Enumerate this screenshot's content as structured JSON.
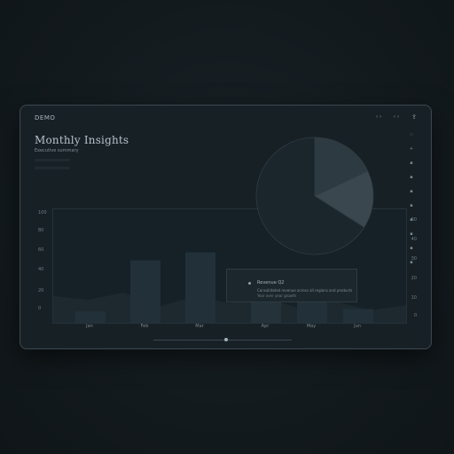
{
  "window": {
    "brand": "DEMO",
    "title": "Monthly Insights",
    "subtitle": "Executive summary"
  },
  "toolbar": {
    "icons": [
      {
        "name": "filter-icon",
        "label": "◦◦"
      },
      {
        "name": "settings-icon",
        "label": "◦◦"
      },
      {
        "name": "share-icon",
        "label": "⇪"
      }
    ]
  },
  "right_rail": {
    "items": [
      "∷",
      "+",
      "▪",
      "▪",
      "▪",
      "▪",
      "▪",
      "▪",
      "▪",
      "▪"
    ]
  },
  "chart": {
    "y_left_ticks": [
      "100",
      "80",
      "60",
      "40",
      "20",
      "0"
    ],
    "y_right_ticks": [
      "60",
      "40",
      "30",
      "20",
      "10",
      "0"
    ],
    "x_labels": [
      "Jan",
      "Feb",
      "Mar",
      "Apr",
      "May",
      "Jun"
    ],
    "bars": [
      10,
      55,
      62,
      40,
      46,
      12
    ],
    "area": [
      30,
      26,
      34,
      18,
      30,
      22,
      28,
      16,
      24,
      14,
      20
    ],
    "pie": [
      0.18,
      0.16,
      0.66
    ],
    "pie_colors": [
      "#2e3a41",
      "#3b474e",
      "#1b262c"
    ]
  },
  "chart_data": {
    "type": "bar",
    "categories": [
      "Jan",
      "Feb",
      "Mar",
      "Apr",
      "May",
      "Jun"
    ],
    "values": [
      10,
      55,
      62,
      40,
      46,
      12
    ],
    "ylim": [
      0,
      100
    ]
  },
  "tooltip": {
    "title": "Revenue Q2",
    "line": "Consolidated revenue across all regions and products",
    "sub": "Year over year growth"
  }
}
